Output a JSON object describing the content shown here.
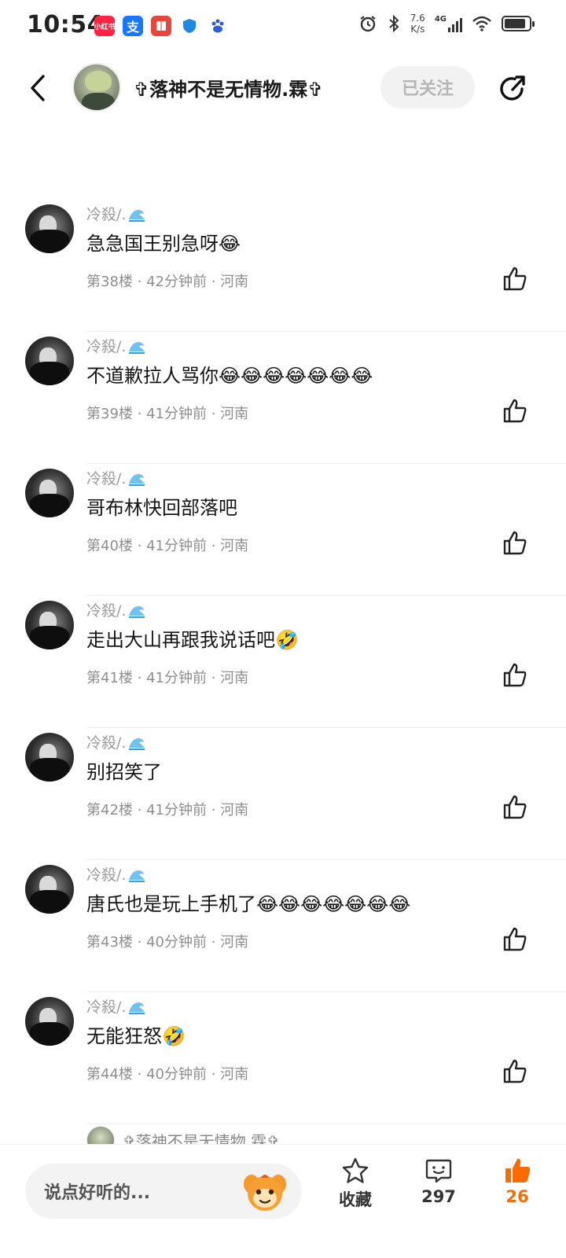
{
  "status_bar": {
    "time": "10:54",
    "app_icons": [
      {
        "name": "xiaohongshu-icon",
        "label": "小红书",
        "color": "#ff2442"
      },
      {
        "name": "alipay-icon",
        "label": "支",
        "color": "#1677ff"
      },
      {
        "name": "book-app-icon",
        "label": "",
        "color": "#e8453c"
      },
      {
        "name": "shield-app-icon",
        "label": "",
        "color": "#1e88e5"
      },
      {
        "name": "baidu-icon",
        "label": "",
        "color": "#2a5fd8"
      }
    ],
    "net_speed_value": "7.6",
    "net_speed_unit": "K/s",
    "network_type": "4G",
    "battery_level": 0.85
  },
  "header": {
    "title": "✞落神不是无情物.霖✞",
    "follow_label": "已关注"
  },
  "comments": [
    {
      "user": "冷殺/.",
      "text": "急急国王别急呀😂",
      "meta": "第38楼 · 42分钟前 · 河南"
    },
    {
      "user": "冷殺/.",
      "text": "不道歉拉人骂你😂😂😂😂😂😂😂",
      "meta": "第39楼 · 41分钟前 · 河南"
    },
    {
      "user": "冷殺/.",
      "text": "哥布林快回部落吧",
      "meta": "第40楼 · 41分钟前 · 河南"
    },
    {
      "user": "冷殺/.",
      "text": "走出大山再跟我说话吧🤣",
      "meta": "第41楼 · 41分钟前 · 河南"
    },
    {
      "user": "冷殺/.",
      "text": "别招笑了",
      "meta": "第42楼 · 41分钟前 · 河南"
    },
    {
      "user": "冷殺/.",
      "text": "唐氏也是玩上手机了😂😂😂😂😂😂😂",
      "meta": "第43楼 · 40分钟前 · 河南"
    },
    {
      "user": "冷殺/.",
      "text": "无能狂怒🤣",
      "meta": "第44楼 · 40分钟前 · 河南"
    }
  ],
  "peek_reply": {
    "user": "✞落神不是无情物.霖✞"
  },
  "bottom_bar": {
    "input_placeholder": "说点好听的...",
    "favorite_label": "收藏",
    "comment_count": "297",
    "like_count": "26",
    "accent_color": "#ff6a00"
  }
}
